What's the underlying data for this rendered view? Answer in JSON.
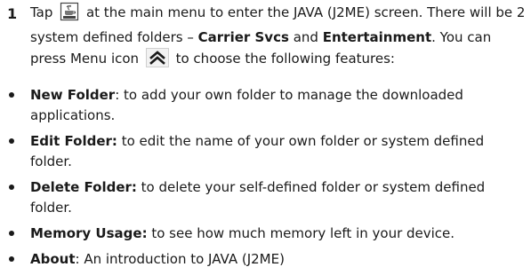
{
  "step": {
    "number": "1",
    "text_a": "Tap",
    "text_b": "at the main menu to enter the JAVA (J2ME) screen. There will be 2 system defined folders –",
    "folder1": "Carrier Svcs",
    "and": "and",
    "folder2": "Entertainment",
    "text_c": ". You can press Menu icon",
    "text_d": "to choose the following features:",
    "java_icon": "java-app-icon",
    "menu_icon": "menu-up-chevron-icon"
  },
  "features": [
    {
      "label": "New Folder",
      "sep": ":",
      "desc": " to add your own folder to manage the downloaded applications."
    },
    {
      "label": "Edit Folder:",
      "sep": "",
      "desc": " to edit the name of your own folder or system defined folder."
    },
    {
      "label": "Delete Folder:",
      "sep": "",
      "desc": " to delete your self-defined folder or system defined folder."
    },
    {
      "label": "Memory Usage:",
      "sep": "",
      "desc": " to see how much memory left in your device."
    },
    {
      "label": "About",
      "sep": ":",
      "desc": " An introduction to JAVA (J2ME)"
    }
  ]
}
